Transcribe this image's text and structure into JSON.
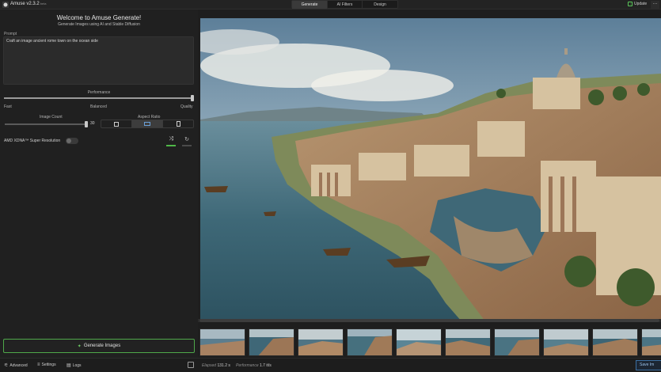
{
  "app": {
    "title": "Amuse v2.3.2",
    "version_tag": "beta"
  },
  "tabs": [
    {
      "label": "Generate",
      "active": true
    },
    {
      "label": "AI Filters",
      "active": false
    },
    {
      "label": "Design",
      "active": false
    }
  ],
  "header": {
    "update_label": "Update",
    "menu_icon": "more-dots-icon"
  },
  "welcome": {
    "title": "Welcome to Amuse Generate!",
    "subtitle": "Generate Images using AI and Stable Diffusion"
  },
  "prompt": {
    "label": "Prompt",
    "value": "Craft an image ancient rome town on the ocean side"
  },
  "performance": {
    "label": "Performance",
    "value": 1.0,
    "ticks": [
      "Fast",
      "Balanced",
      "Quality"
    ]
  },
  "image_count": {
    "label": "Image Count",
    "value": "30",
    "fraction": 1.0
  },
  "aspect_ratio": {
    "label": "Aspect Ratio",
    "options": [
      "square-icon",
      "landscape-icon",
      "portrait-icon"
    ],
    "selected_index": 1
  },
  "amd": {
    "label": "AMD XDNA™ Super Resolution",
    "enabled": false
  },
  "actions": {
    "shuffle_icon": "shuffle-icon",
    "refresh_icon": "refresh-icon"
  },
  "generate_button": {
    "label": "Generate Images"
  },
  "bottom": {
    "advanced": "Advanced",
    "settings": "Settings",
    "logs": "Logs",
    "elapsed_label": "Elapsed",
    "elapsed_value": "131.2 s",
    "performance_label": "Performance",
    "performance_value": "1.7 it/s",
    "save_label": "Save Im"
  },
  "colors": {
    "accent_green": "#4fa84a",
    "save_blue": "#3b6ea0",
    "background": "#1f1f1f"
  }
}
